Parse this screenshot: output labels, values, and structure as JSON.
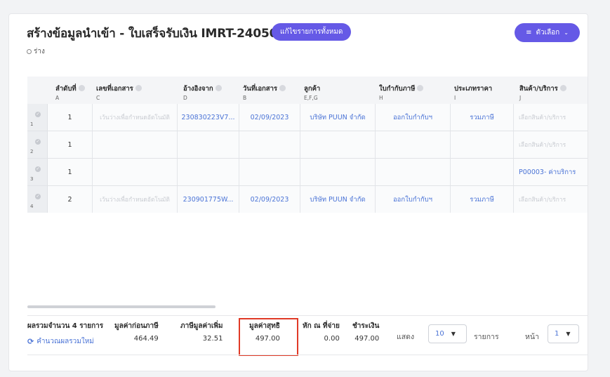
{
  "header": {
    "title": "สร้างข้อมูลนำเข้า - ใบเสร็จรับเงิน IMRT-2405010",
    "edit_all_label": "แก้ไขรายการทั้งหมด",
    "options_label": "ตัวเลือก",
    "status": "ร่าง"
  },
  "table": {
    "columns": [
      {
        "label": "ลำดับที่",
        "letter": "A"
      },
      {
        "label": "เลขที่เอกสาร",
        "letter": "C"
      },
      {
        "label": "อ้างอิงจาก",
        "letter": "D"
      },
      {
        "label": "วันที่เอกสาร",
        "letter": "B"
      },
      {
        "label": "ลูกค้า",
        "letter": "E,F,G"
      },
      {
        "label": "ใบกำกับภาษี",
        "letter": "H"
      },
      {
        "label": "ประเภทราคา",
        "letter": "I"
      },
      {
        "label": "สินค้า/บริการ",
        "letter": "J"
      }
    ],
    "rows": [
      {
        "n": "1",
        "seq": "1",
        "doc": "เว้นว่างเพื่อกำหนดอัตโนมัติ",
        "ref": "230830223V7...",
        "date": "02/09/2023",
        "customer": "บริษัท PUUN จำกัด",
        "tax": "ออกใบกำกับฯ",
        "price": "รวมภาษี",
        "product": "เลือกสินค้า/บริการ"
      },
      {
        "n": "2",
        "seq": "1",
        "doc": "",
        "ref": "",
        "date": "",
        "customer": "",
        "tax": "",
        "price": "",
        "product": "เลือกสินค้า/บริการ"
      },
      {
        "n": "3",
        "seq": "1",
        "doc": "",
        "ref": "",
        "date": "",
        "customer": "",
        "tax": "",
        "price": "",
        "product": "P00003- ค่าบริการ"
      },
      {
        "n": "4",
        "seq": "2",
        "doc": "เว้นว่างเพื่อกำหนดอัตโนมัติ",
        "ref": "230901775W...",
        "date": "02/09/2023",
        "customer": "บริษัท PUUN จำกัด",
        "tax": "ออกใบกำกับฯ",
        "price": "รวมภาษี",
        "product": "เลือกสินค้า/บริการ"
      }
    ]
  },
  "summary": {
    "total_label": "ผลรวมจำนวน 4 รายการ",
    "recalc_label": "คำนวณผลรวมใหม่",
    "pretax_label": "มูลค่าก่อนภาษี",
    "pretax_value": "464.49",
    "vat_label": "ภาษีมูลค่าเพิ่ม",
    "vat_value": "32.51",
    "net_label": "มูลค่าสุทธิ",
    "net_value": "497.00",
    "wht_label": "หัก ณ ที่จ่าย",
    "wht_value": "0.00",
    "paid_label": "ชำระเงิน",
    "paid_value": "497.00"
  },
  "pager": {
    "show_label": "แสดง",
    "per_page": "10",
    "items_label": "รายการ",
    "page_label": "หน้า",
    "page": "1"
  },
  "colors": {
    "accent": "#6559e6",
    "link": "#4a73d6",
    "highlight": "#e03a26"
  }
}
